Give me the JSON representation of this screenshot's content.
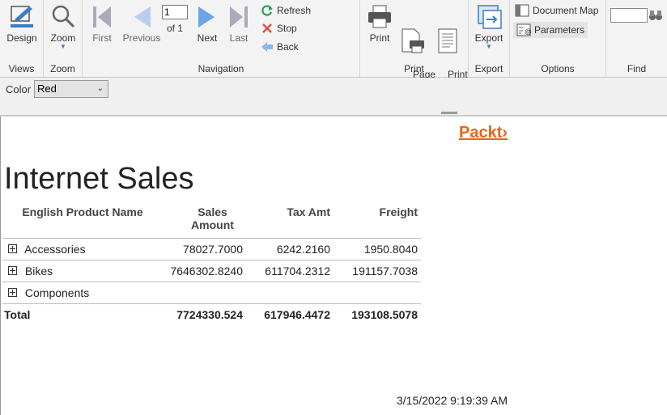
{
  "ribbon": {
    "views": {
      "design_label": "Design",
      "group_label": "Views"
    },
    "zoom": {
      "zoom_label": "Zoom",
      "group_label": "Zoom"
    },
    "navigation": {
      "first_label": "First",
      "previous_label": "Previous",
      "page_value": "1",
      "of_label": "of 1",
      "next_label": "Next",
      "last_label": "Last",
      "refresh_label": "Refresh",
      "stop_label": "Stop",
      "back_label": "Back",
      "group_label": "Navigation"
    },
    "print": {
      "print_label": "Print",
      "page_setup_label": "Page\nSetup",
      "print_layout_label": "Print\nLayout",
      "group_label": "Print"
    },
    "export": {
      "export_label": "Export",
      "group_label": "Export"
    },
    "options": {
      "document_map_label": "Document Map",
      "parameters_label": "Parameters",
      "group_label": "Options"
    },
    "find": {
      "group_label": "Find",
      "value": ""
    }
  },
  "params": {
    "color_label": "Color",
    "color_value": "Red",
    "color_options": [
      "Red"
    ]
  },
  "report": {
    "logo": "Packt›",
    "title": "Internet Sales",
    "headers": [
      "English Product Name",
      "Sales Amount",
      "Tax Amt",
      "Freight"
    ],
    "rows": [
      {
        "name": "Accessories",
        "sales": "78027.7000",
        "tax": "6242.2160",
        "freight": "1950.8040"
      },
      {
        "name": "Bikes",
        "sales": "7646302.8240",
        "tax": "611704.2312",
        "freight": "191157.7038"
      },
      {
        "name": "Components",
        "sales": "",
        "tax": "",
        "freight": ""
      }
    ],
    "total": {
      "label": "Total",
      "sales": "7724330.524",
      "tax": "617946.4472",
      "freight": "193108.5078"
    },
    "timestamp": "3/15/2022 9:19:39 AM"
  },
  "colors": {
    "accent": "#e8641b",
    "nav_blue": "#6aa6e6",
    "ribbon_bg": "#f3f3f3"
  }
}
